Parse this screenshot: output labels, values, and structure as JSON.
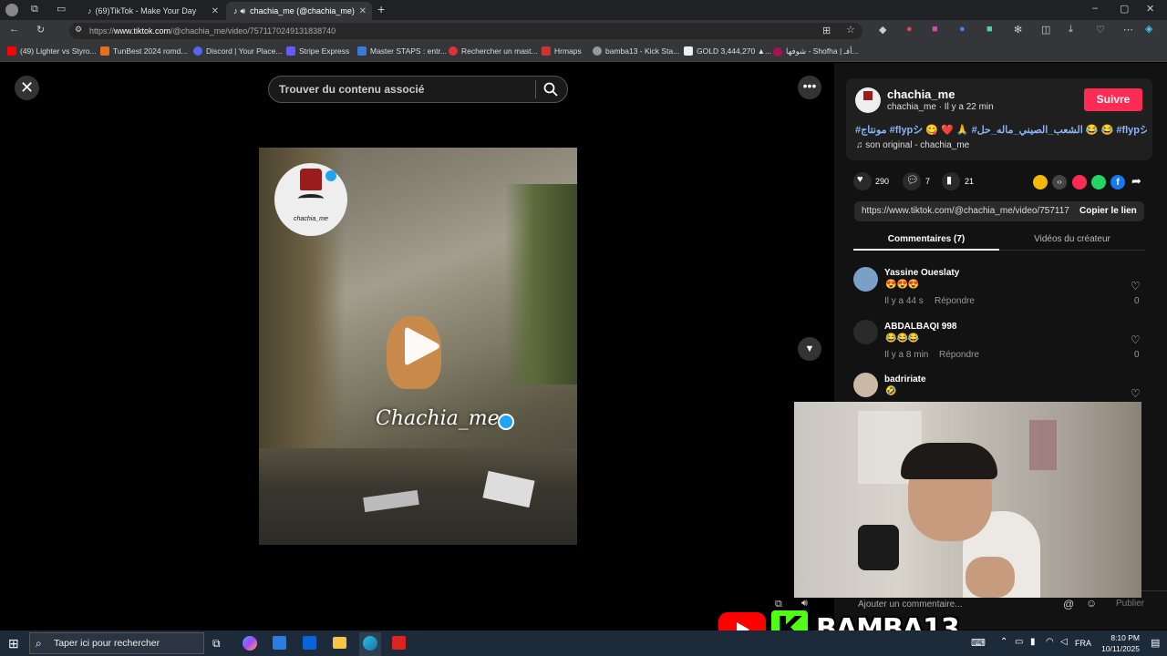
{
  "browser": {
    "tabs": [
      {
        "label": "(69)TikTok - Make Your Day"
      },
      {
        "label": "chachia_me (@chachia_me)"
      }
    ],
    "url_prefix": "https://",
    "url_host": "www.tiktok.com",
    "url_path": "/@chachia_me/video/7571170249131838740",
    "bookmarks": [
      "(49) Lighter vs Styro...",
      "TunBest 2024 romd...",
      "Discord | Your Place...",
      "Stripe Express",
      "Master STAPS : entr...",
      "Rechercher un mast...",
      "Hrmaps",
      "bamba13 - Kick Sta...",
      "GOLD 3,444,270 ▲...",
      "شوفها - Shofha | أفـ..."
    ]
  },
  "video": {
    "search_placeholder": "Trouver du contenu associé",
    "watermark": "Chachia_me",
    "logo_text": "chachia_me"
  },
  "post": {
    "username": "chachia_me",
    "meta": "chachia_me · Il y a 22 min",
    "follow_label": "Suivre",
    "caption": "#مونتاج #flypシ 😋 ❤️ 🙏 #الشعب_الصيني_ماله_حل 😂 😂 #flypシ",
    "sound": "son original - chachia_me",
    "likes": "290",
    "comments": "7",
    "saves": "21",
    "link": "https://www.tiktok.com/@chachia_me/video/757117...",
    "copy_link_label": "Copier le lien",
    "tab_comments": "Commentaires (7)",
    "tab_creator": "Vidéos du créateur"
  },
  "comments": [
    {
      "name": "Yassine Oueslaty",
      "text": "😍😍😍",
      "time": "Il y a 44 s",
      "reply": "Répondre",
      "likes": "0"
    },
    {
      "name": "ABDALBAQI 998",
      "text": "😂😂😂",
      "time": "Il y a 8 min",
      "reply": "Répondre",
      "likes": "0"
    },
    {
      "name": "badririate",
      "text": "🤣",
      "time": "",
      "reply": "",
      "likes": ""
    }
  ],
  "comment_input": {
    "placeholder": "Ajouter un commentaire...",
    "publish_label": "Publier"
  },
  "taskbar": {
    "search_placeholder": "Taper ici pour rechercher",
    "lang": "FRA",
    "time": "8:10 PM",
    "date": "10/11/2025"
  },
  "overlay": {
    "streamer": "BAMBA13",
    "platform_letter": "K"
  },
  "colors": {
    "follow": "#fe2c55",
    "panel": "#121212",
    "kick_green": "#53fc18",
    "youtube_red": "#ff0000"
  }
}
